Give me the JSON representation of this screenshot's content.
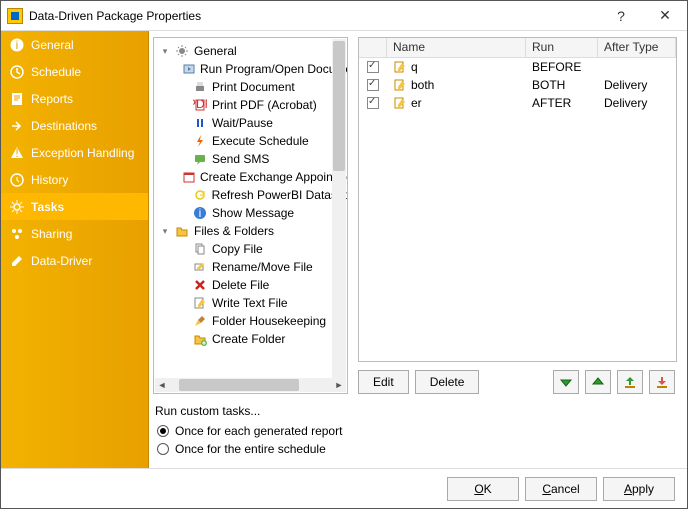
{
  "title": "Data-Driven Package Properties",
  "sidebar": {
    "items": [
      {
        "label": "General",
        "icon": "info"
      },
      {
        "label": "Schedule",
        "icon": "clock"
      },
      {
        "label": "Reports",
        "icon": "report"
      },
      {
        "label": "Destinations",
        "icon": "arrow-out"
      },
      {
        "label": "Exception Handling",
        "icon": "warning"
      },
      {
        "label": "History",
        "icon": "history"
      },
      {
        "label": "Tasks",
        "icon": "gear",
        "selected": true
      },
      {
        "label": "Sharing",
        "icon": "share"
      },
      {
        "label": "Data-Driver",
        "icon": "pencil"
      }
    ]
  },
  "tree": [
    {
      "type": "group",
      "label": "General",
      "icon": "gear",
      "indent": 0
    },
    {
      "type": "item",
      "label": "Run Program/Open Document",
      "icon": "run",
      "indent": 1
    },
    {
      "type": "item",
      "label": "Print Document",
      "icon": "printer",
      "indent": 1
    },
    {
      "type": "item",
      "label": "Print PDF (Acrobat)",
      "icon": "pdf",
      "indent": 1
    },
    {
      "type": "item",
      "label": "Wait/Pause",
      "icon": "pause",
      "indent": 1
    },
    {
      "type": "item",
      "label": "Execute Schedule",
      "icon": "bolt",
      "indent": 1
    },
    {
      "type": "item",
      "label": "Send SMS",
      "icon": "sms",
      "indent": 1
    },
    {
      "type": "item",
      "label": "Create Exchange Appointment",
      "icon": "calendar",
      "indent": 1
    },
    {
      "type": "item",
      "label": "Refresh PowerBI Dataset",
      "icon": "refresh",
      "indent": 1
    },
    {
      "type": "item",
      "label": "Show Message",
      "icon": "info",
      "indent": 1
    },
    {
      "type": "group",
      "label": "Files & Folders",
      "icon": "folder",
      "indent": 0
    },
    {
      "type": "item",
      "label": "Copy File",
      "icon": "copy",
      "indent": 1
    },
    {
      "type": "item",
      "label": "Rename/Move File",
      "icon": "rename",
      "indent": 1
    },
    {
      "type": "item",
      "label": "Delete File",
      "icon": "delete",
      "indent": 1
    },
    {
      "type": "item",
      "label": "Write Text File",
      "icon": "write",
      "indent": 1
    },
    {
      "type": "item",
      "label": "Folder Housekeeping",
      "icon": "broom",
      "indent": 1
    },
    {
      "type": "item",
      "label": "Create Folder",
      "icon": "folder-new",
      "indent": 1
    }
  ],
  "grid": {
    "columns": {
      "name": "Name",
      "run": "Run",
      "after": "After Type"
    },
    "rows": [
      {
        "checked": true,
        "name": "q",
        "run": "BEFORE",
        "after": ""
      },
      {
        "checked": true,
        "name": "both",
        "run": "BOTH",
        "after": "Delivery"
      },
      {
        "checked": true,
        "name": "er",
        "run": "AFTER",
        "after": "Delivery"
      }
    ]
  },
  "buttons": {
    "edit": "Edit",
    "delete": "Delete"
  },
  "runCustom": {
    "heading": "Run custom tasks...",
    "opt1": "Once for each generated report",
    "opt2": "Once for the entire schedule",
    "selected": 0
  },
  "footer": {
    "ok": "OK",
    "cancel": "Cancel",
    "apply": "Apply"
  }
}
